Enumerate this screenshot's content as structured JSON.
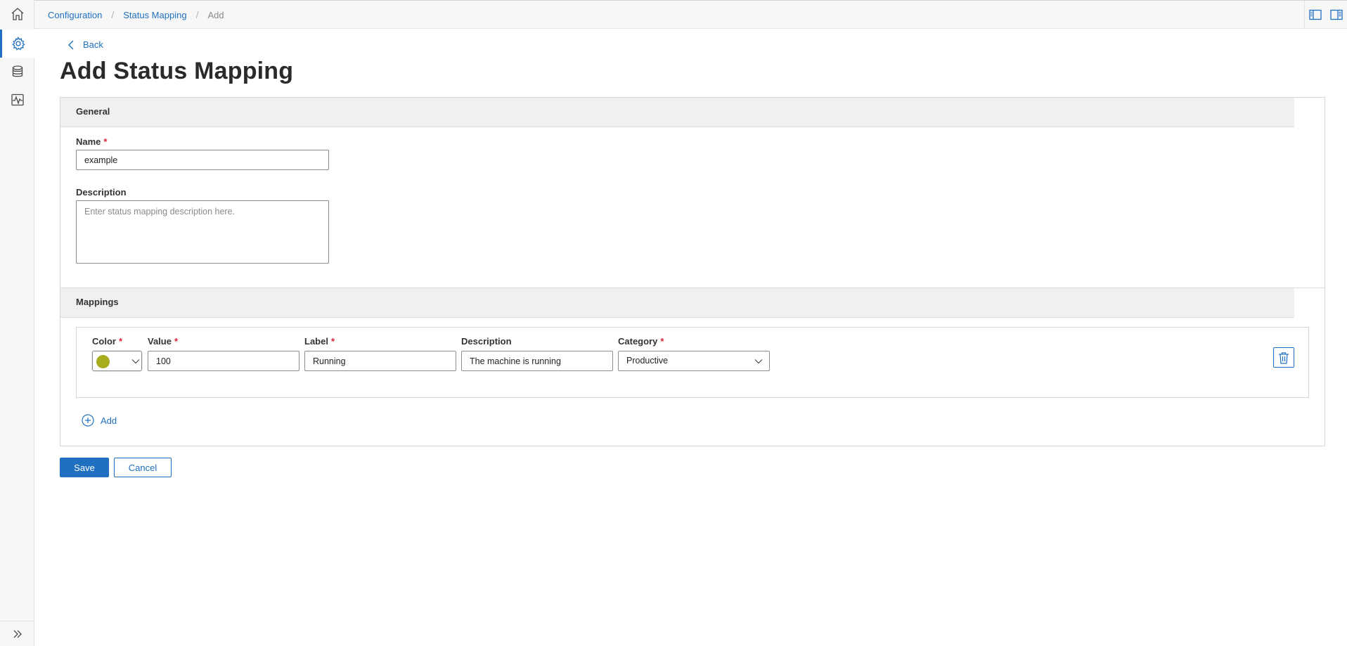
{
  "rail": {
    "items": [
      {
        "icon": "home-icon"
      },
      {
        "icon": "gear-icon",
        "active": true
      },
      {
        "icon": "database-icon"
      },
      {
        "icon": "monitoring-icon"
      }
    ],
    "expand_icon": "double-chevron-right-icon"
  },
  "breadcrumb": {
    "items": [
      "Configuration",
      "Status Mapping"
    ],
    "current": "Add",
    "separator": "/"
  },
  "back_label": "Back",
  "page_title": "Add Status Mapping",
  "general": {
    "heading": "General",
    "name_label": "Name",
    "name_value": "example",
    "description_label": "Description",
    "description_placeholder": "Enter status mapping description here."
  },
  "mappings": {
    "heading": "Mappings",
    "columns": {
      "color": "Color",
      "value": "Value",
      "label": "Label",
      "description": "Description",
      "category": "Category"
    },
    "rows": [
      {
        "color": "#a8ad1e",
        "value": "100",
        "label": "Running",
        "description": "The machine is running",
        "category": "Productive"
      }
    ],
    "add_label": "Add"
  },
  "actions": {
    "save_label": "Save",
    "cancel_label": "Cancel"
  },
  "required_marker": "*",
  "colors": {
    "accent": "#1f70c1",
    "required": "#d72339"
  }
}
